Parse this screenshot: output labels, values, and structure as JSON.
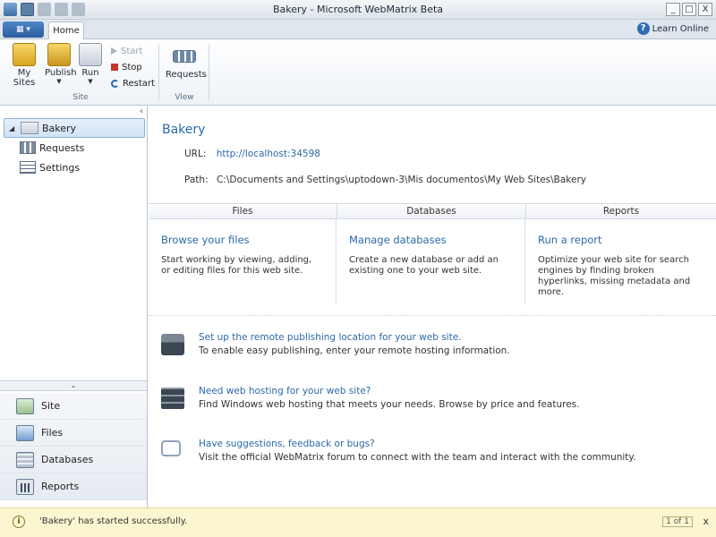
{
  "window": {
    "title": "Bakery - Microsoft WebMatrix Beta",
    "controls": [
      "_",
      "□",
      "X"
    ]
  },
  "ribbon": {
    "tab_home": "Home",
    "help_link": "Learn Online",
    "help_icon": "?",
    "groups": {
      "site": {
        "label": "Site",
        "my_sites": "My Sites",
        "publish": "Publish",
        "run": "Run",
        "start": "Start",
        "stop": "Stop",
        "restart": "Restart"
      },
      "view": {
        "label": "View",
        "requests": "Requests"
      }
    }
  },
  "tree": {
    "root": "Bakery",
    "children": [
      "Requests",
      "Settings"
    ]
  },
  "workspaces": [
    "Site",
    "Files",
    "Databases",
    "Reports"
  ],
  "site": {
    "name": "Bakery",
    "url_label": "URL:",
    "url": "http://localhost:34598",
    "path_label": "Path:",
    "path": "C:\\Documents and Settings\\uptodown-3\\Mis documentos\\My Web Sites\\Bakery"
  },
  "columns": [
    {
      "header": "Files",
      "title": "Browse your files",
      "desc": "Start working by viewing, adding, or editing files for this web site."
    },
    {
      "header": "Databases",
      "title": "Manage databases",
      "desc": "Create a new database or add an existing one to your web site."
    },
    {
      "header": "Reports",
      "title": "Run a report",
      "desc": "Optimize your web site for search engines by finding broken hyperlinks, missing metadata and more."
    }
  ],
  "promos": [
    {
      "icon": "publish-server-icon",
      "title": "Set up the remote publishing location for your web site.",
      "desc": "To enable easy publishing, enter your remote hosting information."
    },
    {
      "icon": "hosting-server-icon",
      "title": "Need web hosting for your web site?",
      "desc": "Find Windows web hosting that meets your needs. Browse by price and features."
    },
    {
      "icon": "feedback-chat-icon",
      "title": "Have suggestions, feedback or bugs?",
      "desc": "Visit the official WebMatrix forum to connect with the team and interact with the community."
    }
  ],
  "status": {
    "icon": "i",
    "message": "'Bakery' has started successfully.",
    "pager": "1 of 1",
    "close": "x"
  }
}
